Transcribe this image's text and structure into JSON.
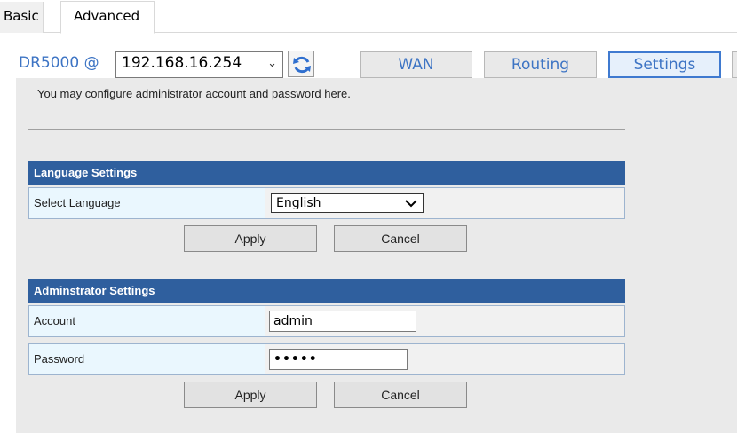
{
  "tabs": {
    "basic": "Basic",
    "advanced": "Advanced"
  },
  "device": {
    "label": "DR5000 @",
    "ip": "192.168.16.254"
  },
  "nav": {
    "wan": "WAN",
    "routing": "Routing",
    "settings": "Settings"
  },
  "intro": "You may configure administrator account and password here.",
  "language_section": {
    "title": "Language Settings",
    "select_label": "Select Language",
    "selected": "English",
    "apply": "Apply",
    "cancel": "Cancel"
  },
  "admin_section": {
    "title": "Adminstrator Settings",
    "account_label": "Account",
    "account_value": "admin",
    "password_label": "Password",
    "password_value": "•••••",
    "apply": "Apply",
    "cancel": "Cancel"
  },
  "colors": {
    "accent": "#3d74c4",
    "section_header": "#2f5f9e",
    "label_bg": "#eaf7fe"
  }
}
